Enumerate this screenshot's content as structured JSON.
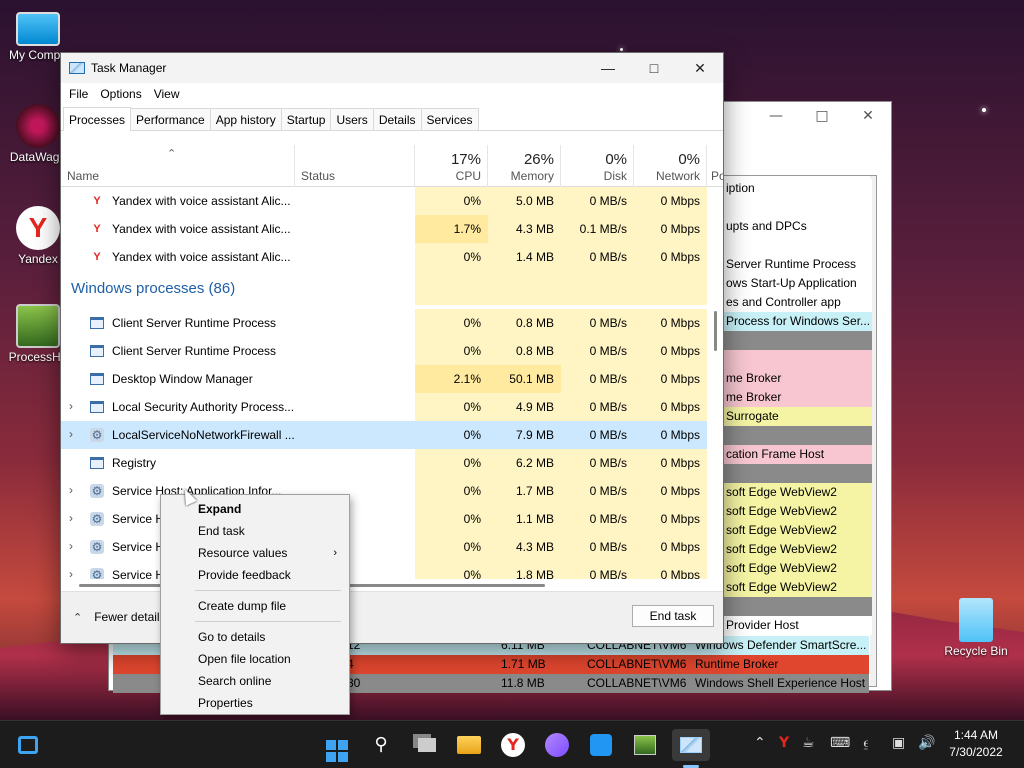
{
  "desktop": {
    "icons": [
      {
        "label": "My Compu"
      },
      {
        "label": "DataWago"
      },
      {
        "label": "Yandex"
      },
      {
        "label": "ProcessHa"
      },
      {
        "label": "Recycle Bin"
      }
    ]
  },
  "bg_window": {
    "right_list": [
      {
        "text": "iption",
        "color": "#ffffff"
      },
      {
        "text": "",
        "color": "#ffffff"
      },
      {
        "text": "upts and DPCs",
        "color": "#ffffff"
      },
      {
        "text": "",
        "color": "#ffffff"
      },
      {
        "text": " Server Runtime Process",
        "color": "#ffffff"
      },
      {
        "text": "ows Start-Up Application",
        "color": "#ffffff"
      },
      {
        "text": "es and Controller app",
        "color": "#ffffff"
      },
      {
        "text": "Process for Windows Ser...",
        "color": "#c7f1f7"
      },
      {
        "text": "",
        "color": "#8a8a8a"
      },
      {
        "text": "",
        "color": "#f7c6d0"
      },
      {
        "text": "me Broker",
        "color": "#f7c6d0"
      },
      {
        "text": "me Broker",
        "color": "#f7c6d0"
      },
      {
        "text": "Surrogate",
        "color": "#f4f4a4"
      },
      {
        "text": "",
        "color": "#8a8a8a"
      },
      {
        "text": "cation Frame Host",
        "color": "#f7c6d0"
      },
      {
        "text": "",
        "color": "#8a8a8a"
      },
      {
        "text": "soft Edge WebView2",
        "color": "#f4f4a4"
      },
      {
        "text": "soft Edge WebView2",
        "color": "#f4f4a4"
      },
      {
        "text": "soft Edge WebView2",
        "color": "#f4f4a4"
      },
      {
        "text": "soft Edge WebView2",
        "color": "#f4f4a4"
      },
      {
        "text": "soft Edge WebView2",
        "color": "#f4f4a4"
      },
      {
        "text": "soft Edge WebView2",
        "color": "#f4f4a4"
      },
      {
        "text": "",
        "color": "#8a8a8a"
      },
      {
        "text": "Provider Host",
        "color": "#ffffff"
      }
    ],
    "bottom_rows": [
      {
        "c1": "12",
        "c2": "6.11 MB",
        "c3": "COLLABNET\\VM6",
        "c4": "Windows Defender SmartScre...",
        "color": "#c7f1f7"
      },
      {
        "c1": "4",
        "c2": "1.71 MB",
        "c3": "COLLABNET\\VM6",
        "c4": "Runtime Broker",
        "color": "#e0462e"
      },
      {
        "c1": "30",
        "c2": "11.8 MB",
        "c3": "COLLABNET\\VM6",
        "c4": "Windows Shell Experience Host",
        "color": "#8a8a8a"
      }
    ]
  },
  "task_manager": {
    "title": "Task Manager",
    "menu": [
      "File",
      "Options",
      "View"
    ],
    "tabs": [
      "Processes",
      "Performance",
      "App history",
      "Startup",
      "Users",
      "Details",
      "Services"
    ],
    "active_tab": "Processes",
    "columns": {
      "name": "Name",
      "status": "Status",
      "cpu": {
        "pct": "17%",
        "label": "CPU"
      },
      "memory": {
        "pct": "26%",
        "label": "Memory"
      },
      "disk": {
        "pct": "0%",
        "label": "Disk"
      },
      "network": {
        "pct": "0%",
        "label": "Network"
      },
      "power": "Po"
    },
    "rows": [
      {
        "kind": "proc",
        "expand": "",
        "icon": "yandex",
        "name": "Yandex with voice assistant Alic...",
        "cpu": "0%",
        "mem": "5.0 MB",
        "disk": "0 MB/s",
        "net": "0 Mbps",
        "sel": false,
        "cpuHeat": 1
      },
      {
        "kind": "proc",
        "expand": "",
        "icon": "yandex",
        "name": "Yandex with voice assistant Alic...",
        "cpu": "1.7%",
        "mem": "4.3 MB",
        "disk": "0.1 MB/s",
        "net": "0 Mbps",
        "sel": false,
        "cpuHeat": 2
      },
      {
        "kind": "proc",
        "expand": "",
        "icon": "yandex",
        "name": "Yandex with voice assistant Alic...",
        "cpu": "0%",
        "mem": "1.4 MB",
        "disk": "0 MB/s",
        "net": "0 Mbps",
        "sel": false,
        "cpuHeat": 1
      },
      {
        "kind": "group",
        "name": "Windows processes (86)"
      },
      {
        "kind": "proc",
        "expand": "",
        "icon": "window",
        "name": "Client Server Runtime Process",
        "cpu": "0%",
        "mem": "0.8 MB",
        "disk": "0 MB/s",
        "net": "0 Mbps",
        "sel": false,
        "cpuHeat": 1
      },
      {
        "kind": "proc",
        "expand": "",
        "icon": "window",
        "name": "Client Server Runtime Process",
        "cpu": "0%",
        "mem": "0.8 MB",
        "disk": "0 MB/s",
        "net": "0 Mbps",
        "sel": false,
        "cpuHeat": 1
      },
      {
        "kind": "proc",
        "expand": "",
        "icon": "window",
        "name": "Desktop Window Manager",
        "cpu": "2.1%",
        "mem": "50.1 MB",
        "disk": "0 MB/s",
        "net": "0 Mbps",
        "sel": false,
        "cpuHeat": 2
      },
      {
        "kind": "proc",
        "expand": "›",
        "icon": "window",
        "name": "Local Security Authority Process...",
        "cpu": "0%",
        "mem": "4.9 MB",
        "disk": "0 MB/s",
        "net": "0 Mbps",
        "sel": false,
        "cpuHeat": 1
      },
      {
        "kind": "proc",
        "expand": "›",
        "icon": "gear",
        "name": "LocalServiceNoNetworkFirewall ...",
        "cpu": "0%",
        "mem": "7.9 MB",
        "disk": "0 MB/s",
        "net": "0 Mbps",
        "sel": true,
        "cpuHeat": 1
      },
      {
        "kind": "proc",
        "expand": "",
        "icon": "window",
        "name": "Registry",
        "cpu": "0%",
        "mem": "6.2 MB",
        "disk": "0 MB/s",
        "net": "0 Mbps",
        "sel": false,
        "cpuHeat": 1
      },
      {
        "kind": "proc",
        "expand": "›",
        "icon": "gear",
        "name": "Service Host: Application Infor...",
        "cpu": "0%",
        "mem": "1.7 MB",
        "disk": "0 MB/s",
        "net": "0 Mbps",
        "sel": false,
        "cpuHeat": 1
      },
      {
        "kind": "proc",
        "expand": "›",
        "icon": "gear",
        "name": "Service H",
        "cpu": "0%",
        "mem": "1.1 MB",
        "disk": "0 MB/s",
        "net": "0 Mbps",
        "sel": false,
        "cpuHeat": 1
      },
      {
        "kind": "proc",
        "expand": "›",
        "icon": "gear",
        "name": "Service H",
        "cpu": "0%",
        "mem": "4.3 MB",
        "disk": "0 MB/s",
        "net": "0 Mbps",
        "sel": false,
        "cpuHeat": 1
      },
      {
        "kind": "proc",
        "expand": "›",
        "icon": "gear",
        "name": "Service H",
        "cpu": "0%",
        "mem": "1.8 MB",
        "disk": "0 MB/s",
        "net": "0 Mbps",
        "sel": false,
        "cpuHeat": 1
      }
    ],
    "footer": {
      "fewer_details": "Fewer details",
      "end_task": "End task"
    }
  },
  "context_menu": {
    "items": [
      {
        "label": "Expand",
        "bold": true,
        "submenu": false
      },
      {
        "label": "End task",
        "bold": false,
        "submenu": false
      },
      {
        "label": "Resource values",
        "bold": false,
        "submenu": true
      },
      {
        "label": "Provide feedback",
        "bold": false,
        "submenu": false
      },
      {
        "sep": true
      },
      {
        "label": "Create dump file",
        "bold": false,
        "submenu": false
      },
      {
        "sep": true
      },
      {
        "label": "Go to details",
        "bold": false,
        "submenu": false
      },
      {
        "label": "Open file location",
        "bold": false,
        "submenu": false
      },
      {
        "label": "Search online",
        "bold": false,
        "submenu": false
      },
      {
        "label": "Properties",
        "bold": false,
        "submenu": false
      }
    ]
  },
  "taskbar": {
    "clock_time": "1:44 AM",
    "clock_date": "7/30/2022"
  },
  "colors": {
    "heat_light": "#fff4c4",
    "heat_mid": "#ffeaa0",
    "selection": "#cce8ff",
    "group_text": "#1e5fa8"
  }
}
